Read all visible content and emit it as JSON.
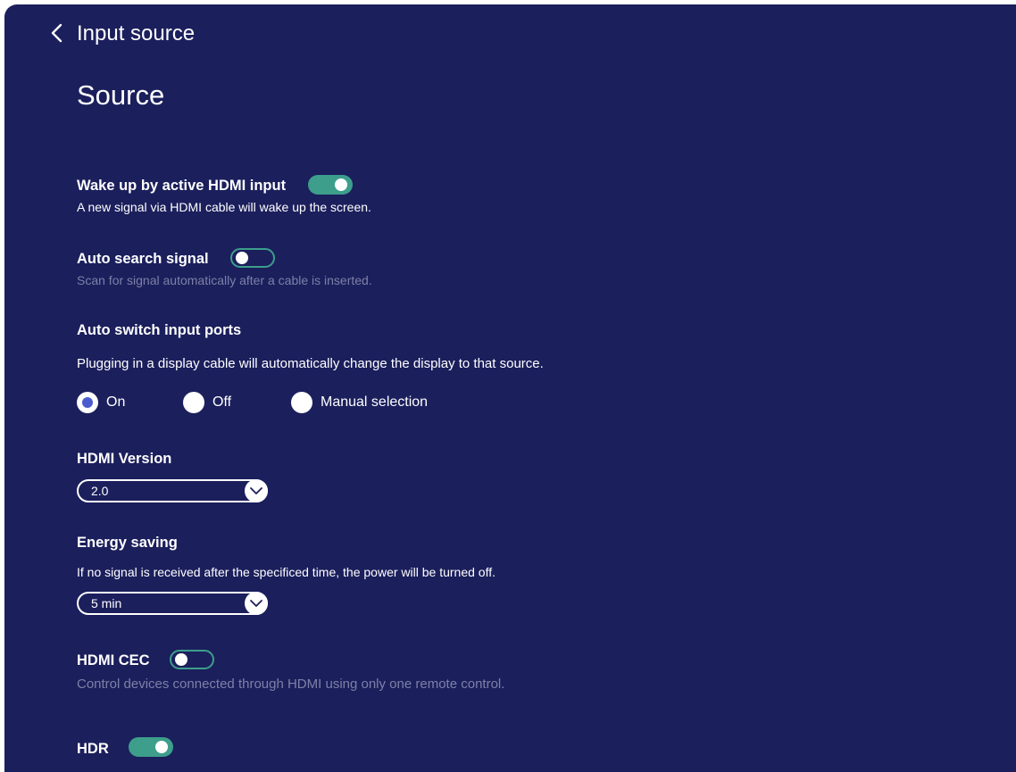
{
  "header": {
    "back_icon": "chevron-left-icon",
    "title": "Input source"
  },
  "page": {
    "title": "Source"
  },
  "settings": {
    "wake_hdmi": {
      "title": "Wake up by active HDMI input",
      "description": "A new signal via HDMI cable will wake up the screen.",
      "enabled": true
    },
    "auto_search": {
      "title": "Auto search signal",
      "description": "Scan for signal automatically after a cable is inserted.",
      "enabled": false
    },
    "auto_switch": {
      "title": "Auto switch input ports",
      "description": "Plugging in a display cable will automatically change the display to that source.",
      "options": [
        "On",
        "Off",
        "Manual selection"
      ],
      "selected": "On"
    },
    "hdmi_version": {
      "title": "HDMI Version",
      "value": "2.0"
    },
    "energy_saving": {
      "title": "Energy saving",
      "description": "If no signal is received after the specificed time, the power will be turned off.",
      "value": "5 min"
    },
    "hdmi_cec": {
      "title": "HDMI CEC",
      "description": "Control devices connected through HDMI using only one remote control.",
      "enabled": false
    },
    "hdr": {
      "title": "HDR",
      "enabled": true
    }
  },
  "colors": {
    "background": "#1b1f5c",
    "toggle_on": "#3d9e8c",
    "radio_selected": "#4b5bd0",
    "text_dim": "#7d80a6"
  }
}
